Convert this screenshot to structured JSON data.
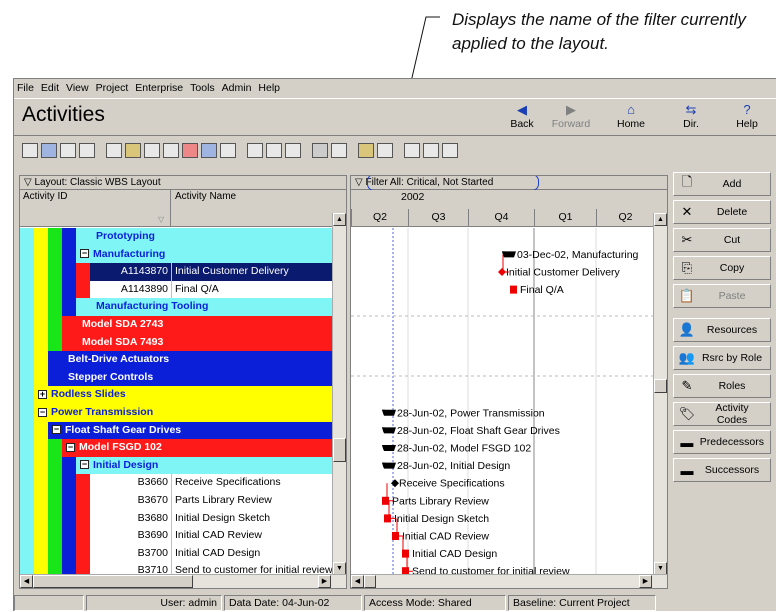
{
  "callout": "Displays the name of the filter currently applied to the layout.",
  "menu": [
    "File",
    "Edit",
    "View",
    "Project",
    "Enterprise",
    "Tools",
    "Admin",
    "Help"
  ],
  "title": "Activities",
  "nav": {
    "back": "Back",
    "forward": "Forward",
    "home": "Home",
    "dir": "Dir.",
    "help": "Help"
  },
  "layout_label": "Layout: Classic WBS Layout",
  "filter_label": "Filter All: Critical, Not Started",
  "columns": {
    "id": "Activity ID",
    "name": "Activity Name"
  },
  "timescale": {
    "year": "2002",
    "quarters": [
      "Q2",
      "Q3",
      "Q4",
      "Q1",
      "Q2"
    ]
  },
  "rows": [
    {
      "id": "",
      "name": "Prototyping",
      "level": 3,
      "kind": "wbs",
      "color": "#7ff5f5",
      "bold": true
    },
    {
      "id": "",
      "name": "Manufacturing",
      "level": 3,
      "kind": "wbs",
      "color": "#7ff5f5",
      "bold": true,
      "exp": "−"
    },
    {
      "id": "A1143870",
      "name": "Initial Customer Delivery",
      "level": 4,
      "kind": "act",
      "selected": true
    },
    {
      "id": "A1143890",
      "name": "Final Q/A",
      "level": 4,
      "kind": "act"
    },
    {
      "id": "",
      "name": "Manufacturing Tooling",
      "level": 3,
      "kind": "wbs",
      "color": "#7ff5f5",
      "bold": true
    },
    {
      "id": "",
      "name": "Model SDA 2743",
      "level": 2,
      "kind": "wbs",
      "color": "#ff1a1a",
      "bold": true,
      "text": "#fff"
    },
    {
      "id": "",
      "name": "Model SDA 7493",
      "level": 2,
      "kind": "wbs",
      "color": "#ff1a1a",
      "bold": true,
      "text": "#fff"
    },
    {
      "id": "",
      "name": "Belt-Drive Actuators",
      "level": 1,
      "kind": "wbs",
      "color": "#0b1fd9",
      "bold": true,
      "text": "#fff"
    },
    {
      "id": "",
      "name": "Stepper Controls",
      "level": 1,
      "kind": "wbs",
      "color": "#0b1fd9",
      "bold": true,
      "text": "#fff"
    },
    {
      "id": "",
      "name": "Rodless Slides",
      "level": 0,
      "kind": "wbs",
      "color": "#ffff00",
      "bold": true,
      "text": "#0b1fd9",
      "exp": "+"
    },
    {
      "id": "",
      "name": "Power Transmission",
      "level": 0,
      "kind": "wbs",
      "color": "#ffff00",
      "bold": true,
      "text": "#0b1fd9",
      "exp": "−"
    },
    {
      "id": "",
      "name": "Float Shaft Gear Drives",
      "level": 1,
      "kind": "wbs",
      "color": "#0b1fd9",
      "bold": true,
      "text": "#fff",
      "exp": "−"
    },
    {
      "id": "",
      "name": "Model FSGD 102",
      "level": 2,
      "kind": "wbs",
      "color": "#ff1a1a",
      "bold": true,
      "text": "#fff",
      "exp": "−"
    },
    {
      "id": "",
      "name": "Initial Design",
      "level": 3,
      "kind": "wbs",
      "color": "#7ff5f5",
      "bold": true,
      "exp": "−"
    },
    {
      "id": "B3660",
      "name": "Receive Specifications",
      "level": 4,
      "kind": "act"
    },
    {
      "id": "B3670",
      "name": "Parts Library Review",
      "level": 4,
      "kind": "act"
    },
    {
      "id": "B3680",
      "name": "Initial Design Sketch",
      "level": 4,
      "kind": "act"
    },
    {
      "id": "B3690",
      "name": "Initial CAD Review",
      "level": 4,
      "kind": "act"
    },
    {
      "id": "B3700",
      "name": "Initial CAD Design",
      "level": 4,
      "kind": "act"
    },
    {
      "id": "B3710",
      "name": "Send to customer for initial review",
      "level": 4,
      "kind": "act"
    }
  ],
  "gantt_labels": [
    {
      "row": 1,
      "text": "03-Dec-02, Manufacturing"
    },
    {
      "row": 2,
      "text": "Initial Customer Delivery"
    },
    {
      "row": 3,
      "text": "Final Q/A"
    },
    {
      "row": 10,
      "text": "28-Jun-02, Power Transmission"
    },
    {
      "row": 11,
      "text": "28-Jun-02, Float Shaft Gear Drives"
    },
    {
      "row": 12,
      "text": "28-Jun-02, Model FSGD 102"
    },
    {
      "row": 13,
      "text": "28-Jun-02, Initial Design"
    },
    {
      "row": 14,
      "text": "Receive Specifications"
    },
    {
      "row": 15,
      "text": "Parts Library Review"
    },
    {
      "row": 16,
      "text": "Initial Design Sketch"
    },
    {
      "row": 17,
      "text": "Initial CAD Review"
    },
    {
      "row": 18,
      "text": "Initial CAD Design"
    },
    {
      "row": 19,
      "text": "Send to customer for initial review"
    }
  ],
  "side_buttons": [
    {
      "label": "Add",
      "icon": "add-icon",
      "glyph": "🗋"
    },
    {
      "label": "Delete",
      "icon": "delete-icon",
      "glyph": "✕"
    },
    {
      "label": "Cut",
      "icon": "cut-icon",
      "glyph": "✂"
    },
    {
      "label": "Copy",
      "icon": "copy-icon",
      "glyph": "⎘"
    },
    {
      "label": "Paste",
      "icon": "paste-icon",
      "glyph": "📋",
      "disabled": true
    },
    {
      "label": "Resources",
      "icon": "resources-icon",
      "glyph": "👤"
    },
    {
      "label": "Rsrc by Role",
      "icon": "rsrc-by-role-icon",
      "glyph": "👥"
    },
    {
      "label": "Roles",
      "icon": "roles-icon",
      "glyph": "✎"
    },
    {
      "label": "Activity Codes",
      "icon": "activity-codes-icon",
      "glyph": "🏷"
    },
    {
      "label": "Predecessors",
      "icon": "predecessors-icon",
      "glyph": "▬"
    },
    {
      "label": "Successors",
      "icon": "successors-icon",
      "glyph": "▬"
    }
  ],
  "status": {
    "user": "User: admin",
    "data_date": "Data Date: 04-Jun-02",
    "access": "Access Mode: Shared",
    "baseline": "Baseline: Current Project"
  },
  "colors": {
    "cyan": "#7ff5f5",
    "yellow": "#ffff00",
    "blue": "#0b1fd9",
    "red": "#ff1a1a",
    "green": "#19e619",
    "select": "#0a1a6e"
  }
}
